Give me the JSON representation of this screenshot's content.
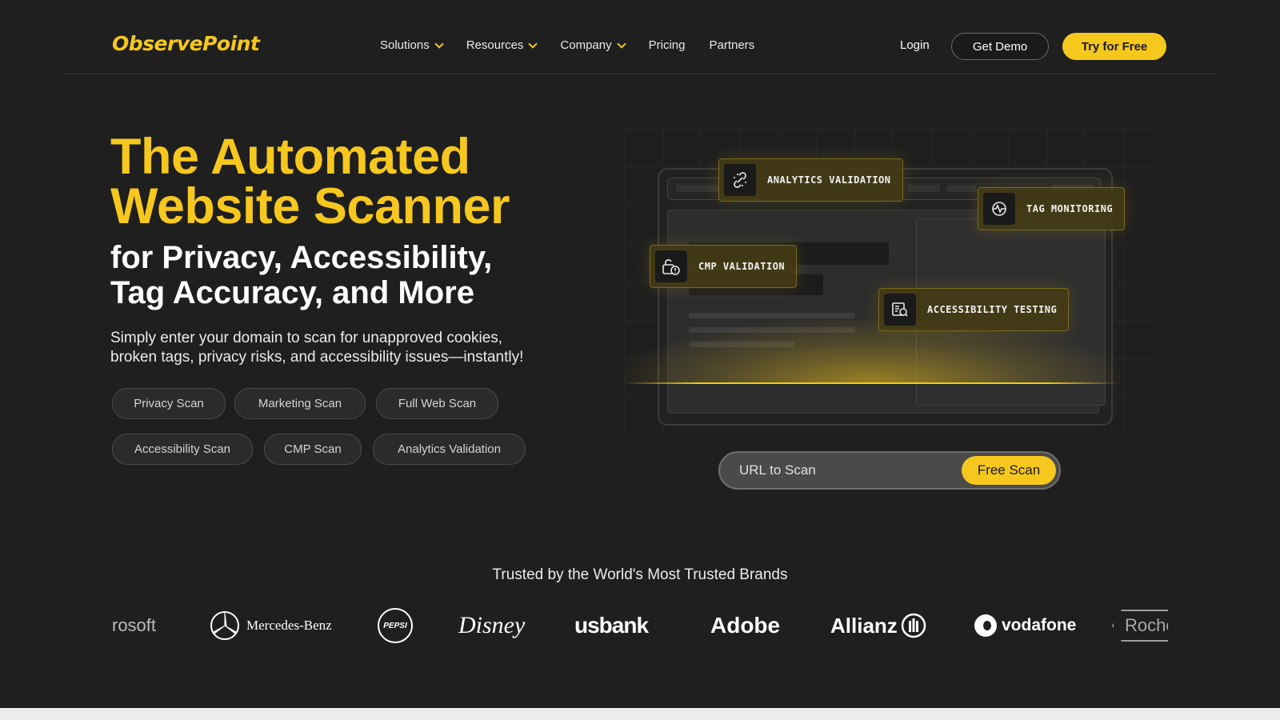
{
  "header": {
    "logo": "ObservePoint",
    "nav": [
      {
        "label": "Solutions",
        "dropdown": true
      },
      {
        "label": "Resources",
        "dropdown": true
      },
      {
        "label": "Company",
        "dropdown": true
      },
      {
        "label": "Pricing",
        "dropdown": false
      },
      {
        "label": "Partners",
        "dropdown": false
      }
    ],
    "login": "Login",
    "demo": "Get Demo",
    "try": "Try for Free"
  },
  "hero": {
    "title_line1": "The Automated",
    "title_line2": "Website Scanner",
    "sub_line1": "for Privacy, Accessibility,",
    "sub_line2": "Tag Accuracy, and More",
    "desc_line1": "Simply enter your domain to scan for unapproved cookies,",
    "desc_line2": "broken tags, privacy risks, and accessibility issues—instantly!",
    "scan_types": [
      "Privacy Scan",
      "Marketing Scan",
      "Full Web Scan",
      "Accessibility Scan",
      "CMP Scan",
      "Analytics Validation"
    ]
  },
  "illustration": {
    "tags": [
      "ANALYTICS VALIDATION",
      "TAG MONITORING",
      "CMP VALIDATION",
      "ACCESSIBILITY TESTING"
    ]
  },
  "scan": {
    "placeholder": "URL to Scan",
    "button": "Free Scan"
  },
  "trusted": {
    "heading": "Trusted by the World's Most Trusted Brands",
    "brands": [
      "rosoft",
      "Mercedes-Benz",
      "PEPSI",
      "Disney",
      "usbank",
      "Adobe",
      "Allianz",
      "vodafone",
      "Roche"
    ]
  },
  "colors": {
    "accent": "#f6c81d",
    "background": "#1f1f1f"
  }
}
